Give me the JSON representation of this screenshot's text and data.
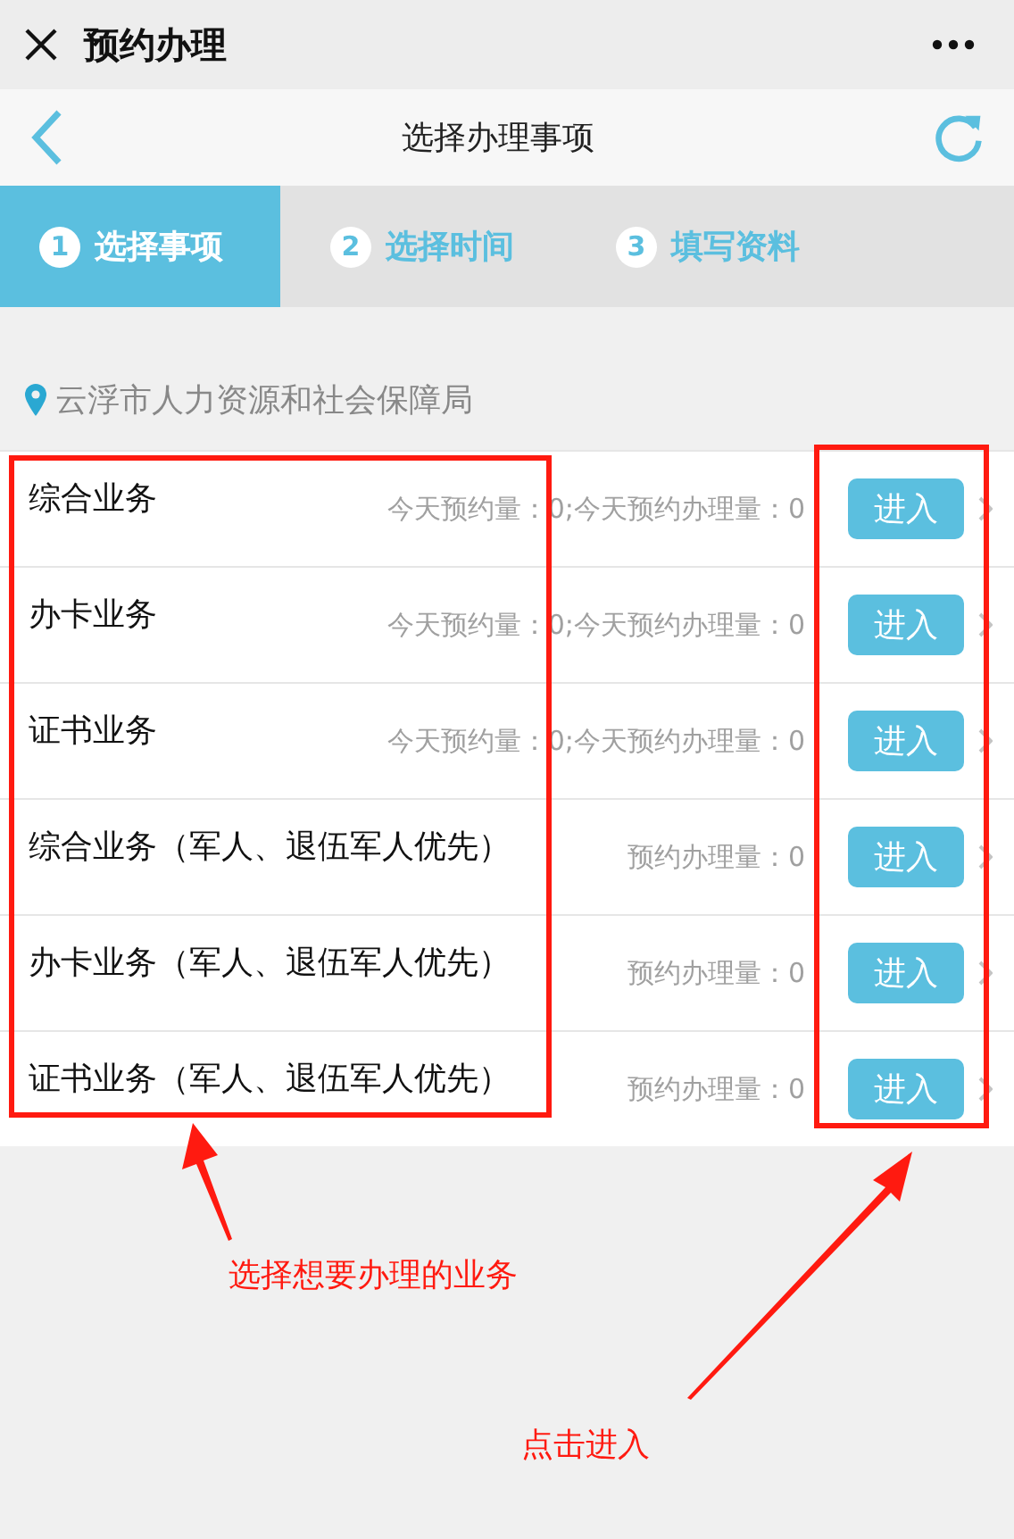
{
  "header": {
    "title": "预约办理"
  },
  "nav": {
    "title": "选择办理事项"
  },
  "steps": [
    {
      "number": "1",
      "label": "选择事项",
      "selected": true
    },
    {
      "number": "2",
      "label": "选择时间",
      "selected": false
    },
    {
      "number": "3",
      "label": "填写资料",
      "selected": false
    }
  ],
  "location": "云浮市人力资源和社会保障局",
  "services": [
    {
      "name": "综合业务",
      "stats": "今天预约量：0;今天预约办理量：0",
      "button": "进入"
    },
    {
      "name": "办卡业务",
      "stats": "今天预约量：0;今天预约办理量：0",
      "button": "进入"
    },
    {
      "name": "证书业务",
      "stats": "今天预约量：0;今天预约办理量：0",
      "button": "进入"
    },
    {
      "name": "综合业务（军人、退伍军人优先）",
      "stats": "预约办理量：0",
      "button": "进入"
    },
    {
      "name": "办卡业务（军人、退伍军人优先）",
      "stats": "预约办理量：0",
      "button": "进入"
    },
    {
      "name": "证书业务（军人、退伍军人优先）",
      "stats": "预约办理量：0",
      "button": "进入"
    }
  ],
  "annotations": [
    {
      "text": "选择想要办理的业务"
    },
    {
      "text": "点击进入"
    }
  ]
}
